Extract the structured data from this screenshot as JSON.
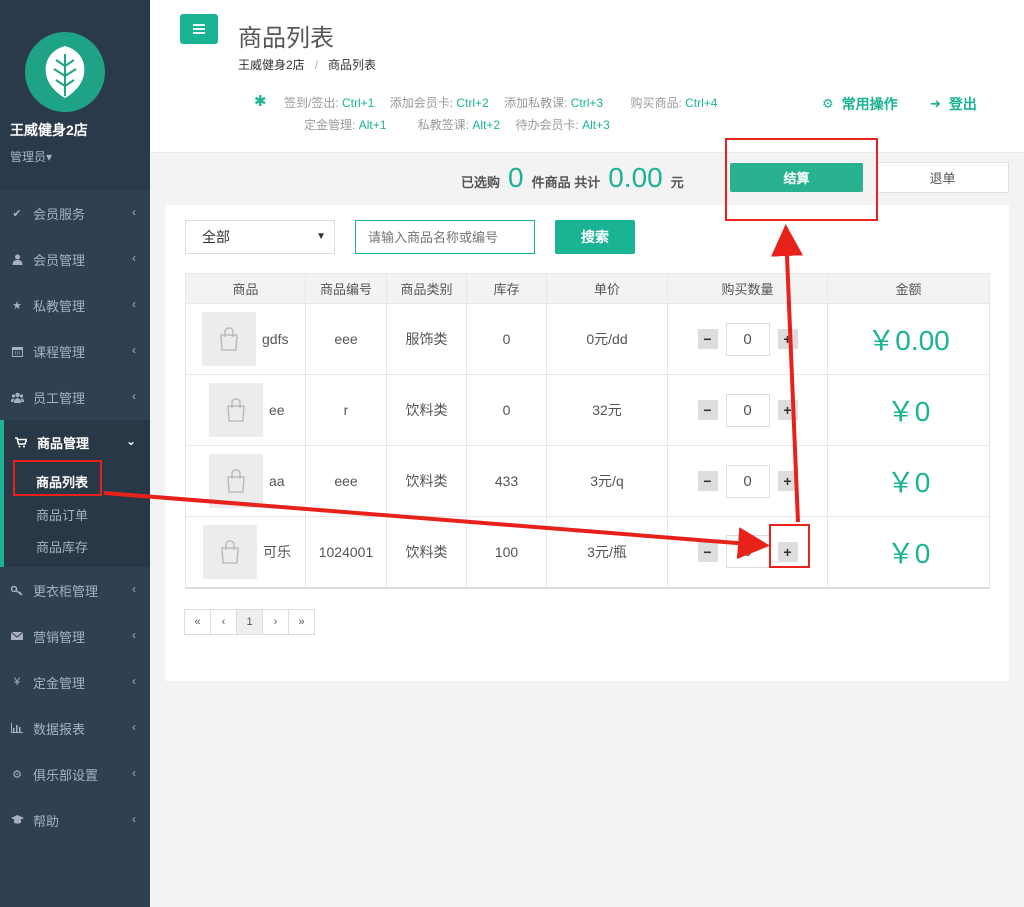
{
  "sidebar": {
    "store_name": "王威健身2店",
    "role": "管理员",
    "items": [
      {
        "label": "会员服务",
        "icon": "check-icon"
      },
      {
        "label": "会员管理",
        "icon": "user-icon"
      },
      {
        "label": "私教管理",
        "icon": "star-icon"
      },
      {
        "label": "课程管理",
        "icon": "calendar-icon"
      },
      {
        "label": "员工管理",
        "icon": "users-icon"
      },
      {
        "label": "商品管理",
        "icon": "cart-icon"
      },
      {
        "label": "更衣柜管理",
        "icon": "key-icon"
      },
      {
        "label": "营销管理",
        "icon": "envelope-icon"
      },
      {
        "label": "定金管理",
        "icon": "yen-icon"
      },
      {
        "label": "数据报表",
        "icon": "bar-chart-icon"
      },
      {
        "label": "俱乐部设置",
        "icon": "gear-icon"
      },
      {
        "label": "帮助",
        "icon": "graduation-cap-icon"
      }
    ],
    "submenu": [
      "商品列表",
      "商品订单",
      "商品库存"
    ]
  },
  "header": {
    "title": "商品列表",
    "breadcrumb": [
      "王威健身2店",
      "商品列表"
    ],
    "shortcuts_row1": [
      {
        "label": "签到/签出:",
        "key": "Ctrl+1"
      },
      {
        "label": "添加会员卡:",
        "key": "Ctrl+2"
      },
      {
        "label": "添加私教课:",
        "key": "Ctrl+3"
      },
      {
        "label": "购买商品:",
        "key": "Ctrl+4"
      }
    ],
    "shortcuts_row2": [
      {
        "label": "定金管理:",
        "key": "Alt+1"
      },
      {
        "label": "私教签课:",
        "key": "Alt+2"
      },
      {
        "label": "待办会员卡:",
        "key": "Alt+3"
      }
    ],
    "common_ops": "常用操作",
    "logout": "登出"
  },
  "summary": {
    "selected_prefix": "已选购",
    "count": "0",
    "items_text": "件商品 共计",
    "total": "0.00",
    "currency_text": "元",
    "checkout": "结算",
    "refund": "退单"
  },
  "filters": {
    "category": "全部",
    "search_placeholder": "请输入商品名称或编号",
    "search_button": "搜索"
  },
  "table": {
    "columns": [
      "商品",
      "商品编号",
      "商品类别",
      "库存",
      "单价",
      "购买数量",
      "金额"
    ],
    "rows": [
      {
        "name": "gdfs",
        "code": "eee",
        "category": "服饰类",
        "stock": "0",
        "price": "0元/dd",
        "qty": "0",
        "amount": "￥0.00"
      },
      {
        "name": "ee",
        "code": "r",
        "category": "饮料类",
        "stock": "0",
        "price": "32元",
        "qty": "0",
        "amount": "￥0"
      },
      {
        "name": "aa",
        "code": "eee",
        "category": "饮料类",
        "stock": "433",
        "price": "3元/q",
        "qty": "0",
        "amount": "￥0"
      },
      {
        "name": "可乐",
        "code": "1024001",
        "category": "饮料类",
        "stock": "100",
        "price": "3元/瓶",
        "qty": "0",
        "amount": "￥0"
      }
    ]
  },
  "pagination": [
    "«",
    "‹",
    "1",
    "›",
    "»"
  ],
  "colors": {
    "accent": "#1ab394",
    "sidebar": "#2f4050",
    "annotation": "#e8221b"
  }
}
